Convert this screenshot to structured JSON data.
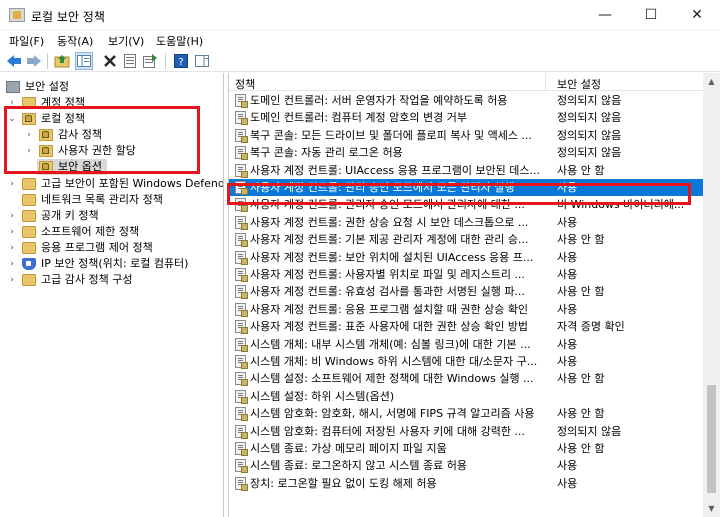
{
  "window": {
    "title": "로컬 보안 정책"
  },
  "window_controls": {
    "minimize": "—",
    "maximize": "☐",
    "close": "✕"
  },
  "menu": [
    "파일(F)",
    "동작(A)",
    "보기(V)",
    "도움말(H)"
  ],
  "tree": {
    "root": "보안 설정",
    "items": [
      "계정 정책",
      "로컬 정책",
      "감사 정책",
      "사용자 권한 할당",
      "보안 옵션",
      "고급 보안이 포함된 Windows Defender",
      "네트워크 목록 관리자 정책",
      "공개 키 정책",
      "소프트웨어 제한 정책",
      "응용 프로그램 제어 정책",
      "IP 보안 정책(위치: 로컬 컴퓨터)",
      "고급 감사 정책 구성"
    ]
  },
  "list": {
    "headers": {
      "policy": "정책",
      "setting": "보안 설정"
    },
    "rows": [
      {
        "policy": "도메인 컨트롤러: 서버 운영자가 작업을 예약하도록 허용",
        "setting": "정의되지 않음"
      },
      {
        "policy": "도메인 컨트롤러: 컴퓨터 계정 암호의 변경 거부",
        "setting": "정의되지 않음"
      },
      {
        "policy": "복구 콘솔: 모든 드라이브 및 폴더에 플로피 복사 및 액세스 ...",
        "setting": "정의되지 않음"
      },
      {
        "policy": "복구 콘솔: 자동 관리 로그온 허용",
        "setting": "정의되지 않음"
      },
      {
        "policy": "사용자 계정 컨트롤: UIAccess 응용 프로그램이 보안된 데스...",
        "setting": "사용 안 함"
      },
      {
        "policy": "사용자 계정 컨트롤: 관리 승인 모드에서 모든 관리자 실행",
        "setting": "사용",
        "selected": true
      },
      {
        "policy": "사용자 계정 컨트롤: 관리자 승인 모드에서 관리자에 대한 ...",
        "setting": "비 Windows 바이너리에..."
      },
      {
        "policy": "사용자 계정 컨트롤: 권한 상승 요청 시 보안 데스크톱으로 ...",
        "setting": "사용"
      },
      {
        "policy": "사용자 계정 컨트롤: 기본 제공 관리자 계정에 대한 관리 승...",
        "setting": "사용 안 함"
      },
      {
        "policy": "사용자 계정 컨트롤: 보안 위치에 설치된 UIAccess 응용 프...",
        "setting": "사용"
      },
      {
        "policy": "사용자 계정 컨트롤: 사용자별 위치로 파일 및 레지스트리 ...",
        "setting": "사용"
      },
      {
        "policy": "사용자 계정 컨트롤: 유효성 검사를 통과한 서명된 실행 파...",
        "setting": "사용 안 함"
      },
      {
        "policy": "사용자 계정 컨트롤: 응용 프로그램 설치할 때 권한 상승 확인",
        "setting": "사용"
      },
      {
        "policy": "사용자 계정 컨트롤: 표준 사용자에 대한 권한 상승 확인 방법",
        "setting": "자격 증명 확인"
      },
      {
        "policy": "시스템 개체: 내부 시스템 개체(예: 심볼 링크)에 대한 기본 ...",
        "setting": "사용"
      },
      {
        "policy": "시스템 개체: 비 Windows 하위 시스템에 대한 대/소문자 구...",
        "setting": "사용"
      },
      {
        "policy": "시스템 설정: 소프트웨어 제한 정책에 대한 Windows 실행 ...",
        "setting": "사용 안 함"
      },
      {
        "policy": "시스템 설정: 하위 시스템(옵션)",
        "setting": ""
      },
      {
        "policy": "시스템 암호화: 암호화, 해시, 서명에 FIPS 규격 알고리즘 사용",
        "setting": "사용 안 함"
      },
      {
        "policy": "시스템 암호화: 컴퓨터에 저장된 사용자 키에 대해 강력한 ...",
        "setting": "정의되지 않음"
      },
      {
        "policy": "시스템 종료: 가상 메모리 페이지 파일 지움",
        "setting": "사용 안 함"
      },
      {
        "policy": "시스템 종료: 로그온하지 않고 시스템 종료 허용",
        "setting": "사용"
      },
      {
        "policy": "장치: 로그온할 필요 없이 도킹 해제 허용",
        "setting": "사용"
      }
    ]
  },
  "toolbar_icons": [
    "back-icon",
    "forward-icon",
    "up-folder-icon",
    "show-tree-icon",
    "delete-icon",
    "properties-icon",
    "export-list-icon",
    "help-icon",
    "show-action-pane-icon"
  ]
}
